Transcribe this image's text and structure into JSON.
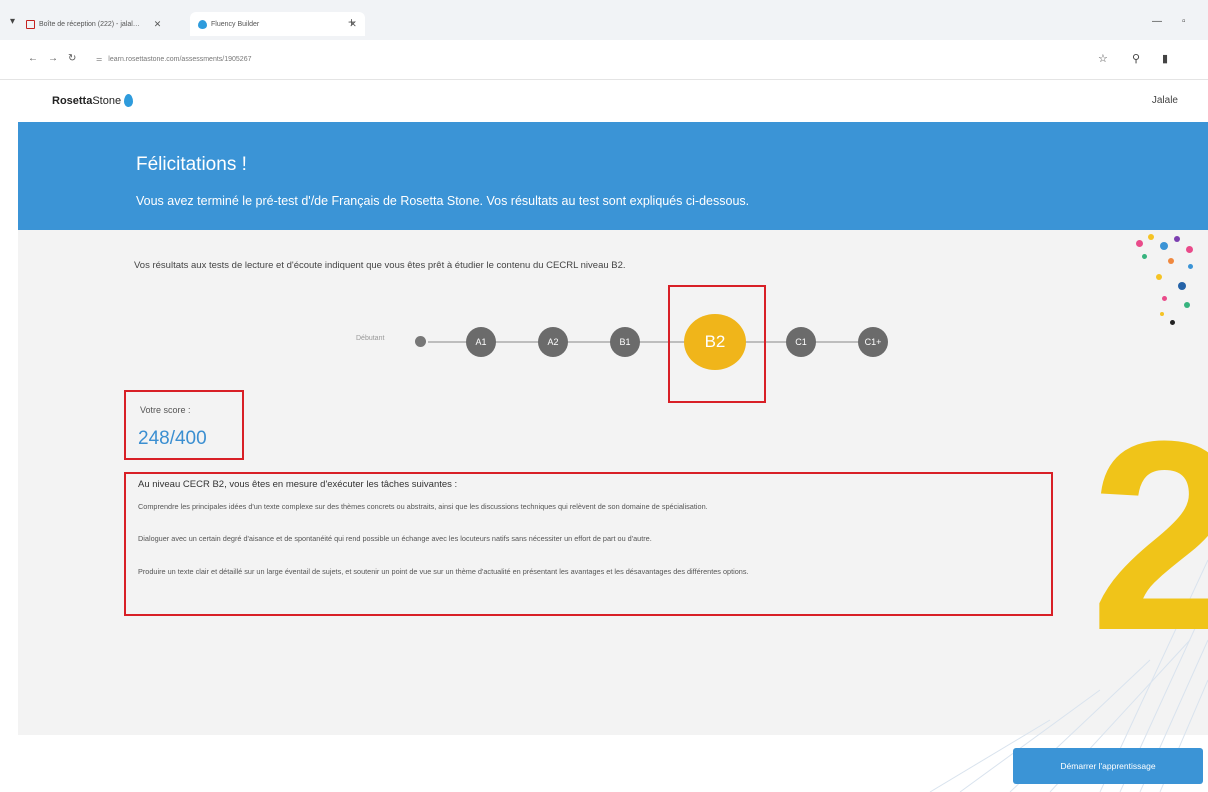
{
  "browser": {
    "tabs": [
      {
        "label": "Boîte de réception (222) - jalal…",
        "favicon": "gmail-icon"
      },
      {
        "label": "Fluency Builder",
        "favicon": "rosetta-drop-icon"
      }
    ],
    "url": "learn.rosettastone.com/assessments/1905267"
  },
  "header": {
    "logo_bold": "Rosetta",
    "logo_light": "Stone",
    "user": "Jalale"
  },
  "banner": {
    "title": "Félicitations !",
    "subtitle": "Vous avez terminé le pré-test d'/de Français de Rosetta Stone. Vos résultats au test sont expliqués ci-dessous."
  },
  "results": {
    "intro": "Vos résultats aux tests de lecture et d'écoute indiquent que vous êtes prêt à étudier le contenu du CECRL niveau B2.",
    "start_label": "Débutant",
    "levels": [
      "A1",
      "A2",
      "B1",
      "B2",
      "C1",
      "C1+"
    ],
    "current_level": "B2",
    "score_label": "Votre score :",
    "score_value": "248/400"
  },
  "tasks": {
    "heading": "Au niveau CECR B2, vous êtes en mesure d'exécuter les tâches suivantes :",
    "items": [
      "Comprendre les principales idées d'un texte complexe sur des thèmes concrets ou abstraits, ainsi que les discussions techniques qui relèvent de son domaine de spécialisation.",
      "Dialoguer avec un certain degré d'aisance et de spontanéité qui rend possible un échange avec les locuteurs natifs sans nécessiter un effort de part ou d'autre.",
      "Produire un texte clair et détaillé sur un large éventail de sujets, et soutenir un point de vue sur un thème d'actualité en présentant les avantages et les désavantages des différentes options."
    ]
  },
  "annotation": {
    "number": "2"
  },
  "cta": {
    "label": "Démarrer l'apprentissage"
  },
  "colors": {
    "accent_blue": "#3b94d6",
    "level_current": "#f0b51a",
    "level_other": "#6b6b6b",
    "highlight_box": "#d81f26",
    "annotation": "#f0c419"
  }
}
